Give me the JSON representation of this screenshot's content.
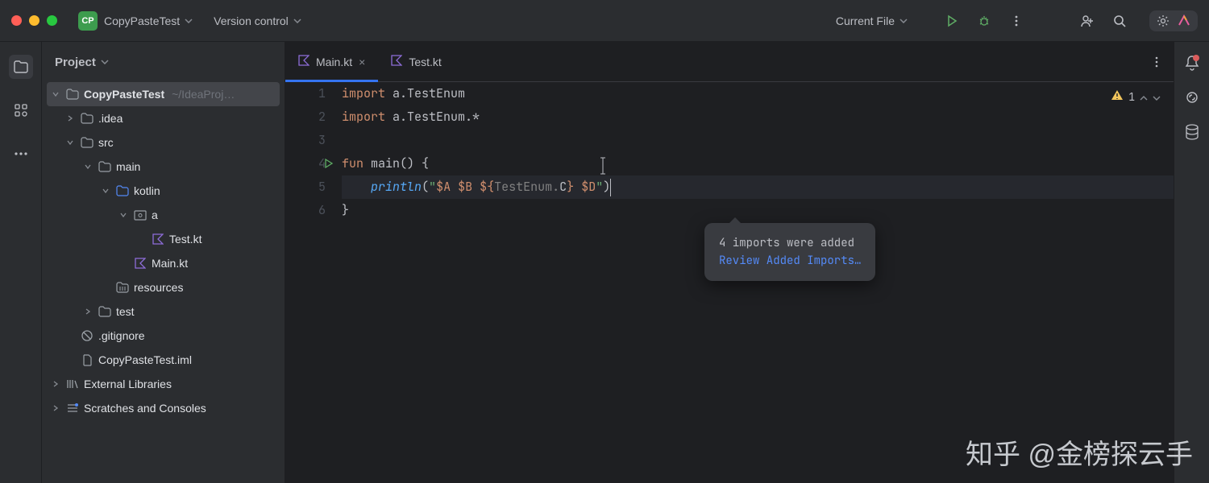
{
  "titlebar": {
    "project_icon": "CP",
    "project_name": "CopyPasteTest",
    "menu_vcs": "Version control",
    "run_config": "Current File"
  },
  "project_panel": {
    "title": "Project",
    "root": {
      "name": "CopyPasteTest",
      "hint": "~/IdeaProj…"
    },
    "nodes": {
      "idea": ".idea",
      "src": "src",
      "main": "main",
      "kotlin": "kotlin",
      "a": "a",
      "test_kt": "Test.kt",
      "main_kt": "Main.kt",
      "resources": "resources",
      "test": "test",
      "gitignore": ".gitignore",
      "iml": "CopyPasteTest.iml",
      "ext_lib": "External Libraries",
      "scratches": "Scratches and Consoles"
    }
  },
  "tabs": {
    "active": "Main.kt",
    "other": "Test.kt"
  },
  "editor": {
    "line_numbers": [
      "1",
      "2",
      "3",
      "4",
      "5",
      "6"
    ],
    "l1_kw": "import",
    "l1_rest": " a.TestEnum",
    "l2_kw": "import",
    "l2_rest": " a.TestEnum.*",
    "l4_kw": "fun",
    "l4_name": " main",
    "l4_rest": "() {",
    "l5_indent": "    ",
    "l5_fn": "println",
    "l5_open": "(",
    "l5_q1": "\"",
    "l5_t1": "$A",
    "l5_s1": " ",
    "l5_t2": "$B",
    "l5_s2": " ",
    "l5_t3a": "${",
    "l5_t3b": "TestEnum",
    "l5_t3c": ".",
    "l5_t3d": "C",
    "l5_t3e": "}",
    "l5_s3": " ",
    "l5_t4": "$D",
    "l5_q2": "\"",
    "l5_close": ")",
    "l6": "}",
    "warn_count": "1"
  },
  "tooltip": {
    "msg": "4 imports were added",
    "link": "Review Added Imports…"
  },
  "watermark": "知乎 @金榜探云手"
}
